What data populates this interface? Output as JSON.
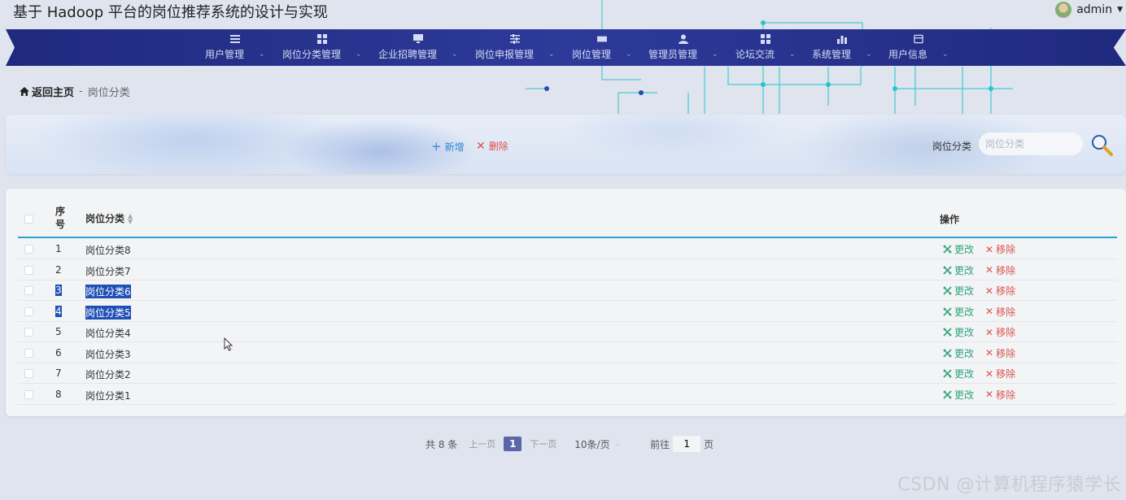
{
  "header": {
    "title": "基于 Hadoop 平台的岗位推荐系统的设计与实现",
    "user": "admin"
  },
  "nav": {
    "items": [
      {
        "label": "用户管理",
        "icon": "list-icon"
      },
      {
        "label": "岗位分类管理",
        "icon": "grid-icon"
      },
      {
        "label": "企业招聘管理",
        "icon": "monitor-icon"
      },
      {
        "label": "岗位申报管理",
        "icon": "sliders-icon"
      },
      {
        "label": "岗位管理",
        "icon": "ticket-icon"
      },
      {
        "label": "管理员管理",
        "icon": "user-icon"
      },
      {
        "label": "论坛交流",
        "icon": "grid-icon"
      },
      {
        "label": "系统管理",
        "icon": "bar-chart-icon"
      },
      {
        "label": "用户信息",
        "icon": "card-icon"
      }
    ]
  },
  "breadcrumb": {
    "home": "返回主页",
    "separator": "-",
    "current": "岗位分类"
  },
  "toolbar": {
    "add_label": "新增",
    "delete_label": "删除",
    "search_label": "岗位分类",
    "search_placeholder": "岗位分类"
  },
  "table": {
    "headers": {
      "index": "序号",
      "name": "岗位分类",
      "actions": "操作"
    },
    "edit_label": "更改",
    "remove_label": "移除",
    "rows": [
      {
        "index": "1",
        "name": "岗位分类8",
        "selected": false
      },
      {
        "index": "2",
        "name": "岗位分类7",
        "selected": false
      },
      {
        "index": "3",
        "name": "岗位分类6",
        "selected": true
      },
      {
        "index": "4",
        "name": "岗位分类5",
        "selected": true
      },
      {
        "index": "5",
        "name": "岗位分类4",
        "selected": false
      },
      {
        "index": "6",
        "name": "岗位分类3",
        "selected": false
      },
      {
        "index": "7",
        "name": "岗位分类2",
        "selected": false
      },
      {
        "index": "8",
        "name": "岗位分类1",
        "selected": false
      }
    ]
  },
  "pagination": {
    "total": "共 8 条",
    "prev": "上一页",
    "current": "1",
    "next": "下一页",
    "page_size": "10条/页",
    "goto_prefix": "前往",
    "goto_value": "1",
    "goto_suffix": "页"
  },
  "watermark": "CSDN @计算机程序猿学长",
  "colors": {
    "nav_bg": "#1f2a7e",
    "accent_blue": "#2b8ad1",
    "edit_green": "#31a37a",
    "danger_red": "#d9534f",
    "selection": "#1f4fb5",
    "pager_active": "#5a66a8"
  }
}
